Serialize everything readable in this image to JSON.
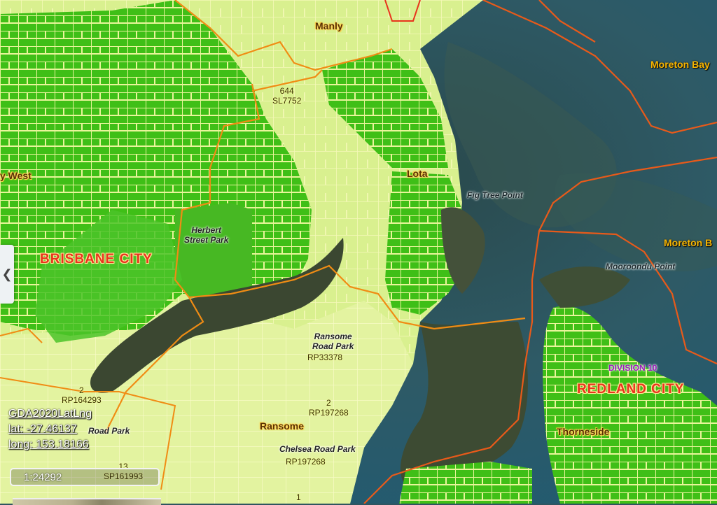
{
  "map": {
    "suburbs": {
      "manly": "Manly",
      "lota": "Lota",
      "ransome": "Ransome",
      "thorneside": "Thorneside",
      "thorneside_bottom": "Thorneside",
      "west": "y West",
      "moreton_bay_1": "Moreton Bay",
      "moreton_bay_2": "Moreton B",
      "lota_ghost": "Lota"
    },
    "cities": {
      "brisbane": "BRISBANE CITY",
      "redland": "REDLAND CITY"
    },
    "division": "DIVISION 10",
    "parks": {
      "herbert_1": "Herbert",
      "herbert_2": "Street Park",
      "ransome_1": "Ransome",
      "ransome_2": "Road Park",
      "chelsea": "Chelsea Road Park",
      "partial_road_park": "Road Park"
    },
    "points": {
      "fig_tree": "Fig Tree Point",
      "mooroondu": "Mooroondu Point"
    },
    "lots": {
      "l644_num": "644",
      "l644_plan": "SL7752",
      "rp33378": "RP33378",
      "rp197268a_num": "2",
      "rp197268a_plan": "RP197268",
      "rp197268b_plan": "RP197268",
      "rp164293_num": "2",
      "rp164293_plan": "RP164293",
      "sp161993_num": "13",
      "sp161993_plan": "SP161993",
      "bottom_num": "1"
    },
    "colors": {
      "water": "#2f5560",
      "residential_green": "#3fbf17",
      "light_parcel": "#d3ee8a",
      "road_yellow": "#f4f7a5",
      "mangrove": "#3a4a32",
      "lga_boundary": "#f08c14",
      "division_boundary": "#e85a1a"
    }
  },
  "coords": {
    "datum": "GDA2020LatLng",
    "lat": "lat: -27.46137",
    "long": "long: 153.18166"
  },
  "scale": "1:24292",
  "icons": {
    "sidebar_toggle": "chevron-left-icon"
  }
}
